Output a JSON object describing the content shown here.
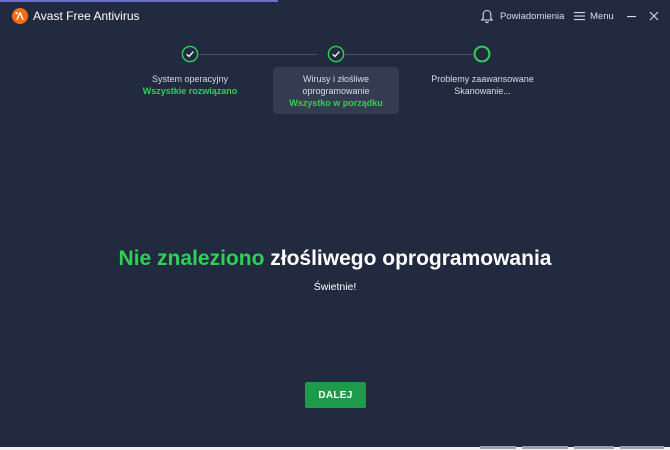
{
  "window": {
    "title": "Avast Free Antivirus",
    "notifications_label": "Powiadomienia",
    "menu_label": "Menu"
  },
  "icons": {
    "logo": "avast-logo-icon",
    "notifications": "bell-icon",
    "menu": "hamburger-icon",
    "minimize": "minimize-icon",
    "close": "close-icon",
    "step_done": "checkmark-circle-icon",
    "step_running": "progress-ring-icon"
  },
  "steps": [
    {
      "title": "System operacyjny",
      "status": "Wszystkie rozwiązano",
      "state": "done"
    },
    {
      "title": "Wirusy i złośliwe oprogramowanie",
      "status": "Wszystko w porządku",
      "state": "done",
      "active": true
    },
    {
      "title": "Problemy zaawansowane",
      "status": "Skanowanie...",
      "state": "running"
    }
  ],
  "result": {
    "headline_highlight": "Nie znaleziono",
    "headline_rest": "złośliwego oprogramowania",
    "subtext": "Świetnie!"
  },
  "actions": {
    "next_label": "DALEJ"
  },
  "colors": {
    "background": "#222a40",
    "accent_green": "#2ed154",
    "button_green": "#1e9b4a",
    "brand_orange": "#f96c15",
    "active_step_bg": "#343c52"
  }
}
